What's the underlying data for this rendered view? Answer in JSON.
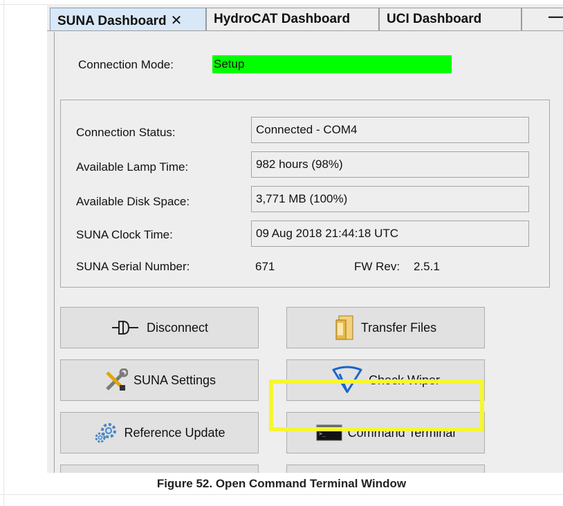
{
  "tabs": [
    {
      "label": "SUNA Dashboard",
      "close": "✕"
    },
    {
      "label": "HydroCAT Dashboard"
    },
    {
      "label": "UCI Dashboard"
    }
  ],
  "window_controls": {
    "minimize": "—"
  },
  "connection_mode": {
    "label": "Connection Mode:",
    "value": "Setup",
    "color": "#00ff00"
  },
  "status": {
    "connection_status": {
      "label": "Connection  Status:",
      "value": "Connected - COM4"
    },
    "lamp_time": {
      "label": "Available Lamp Time:",
      "value": "982 hours (98%)"
    },
    "disk_space": {
      "label": "Available Disk Space:",
      "value": "3,771 MB (100%)"
    },
    "clock_time": {
      "label": "SUNA Clock Time:",
      "value": "09 Aug 2018 21:44:18 UTC"
    },
    "serial_number": {
      "label": "SUNA Serial Number:",
      "value": "671"
    },
    "fw_rev": {
      "label": "FW Rev:",
      "value": "2.5.1"
    }
  },
  "buttons": {
    "disconnect": {
      "label": "Disconnect",
      "icon": "plug-icon"
    },
    "transfer_files": {
      "label": "Transfer Files",
      "icon": "folder-icon"
    },
    "suna_settings": {
      "label": "SUNA Settings",
      "icon": "tools-icon"
    },
    "check_wiper": {
      "label": "Check Wiper",
      "icon": "wiper-icon"
    },
    "reference_update": {
      "label": "Reference Update",
      "icon": "gears-icon"
    },
    "command_terminal": {
      "label": "Command Terminal",
      "icon": "terminal-icon"
    }
  },
  "highlight_color": "#f6f633",
  "caption": "Figure 52. Open Command Terminal Window"
}
